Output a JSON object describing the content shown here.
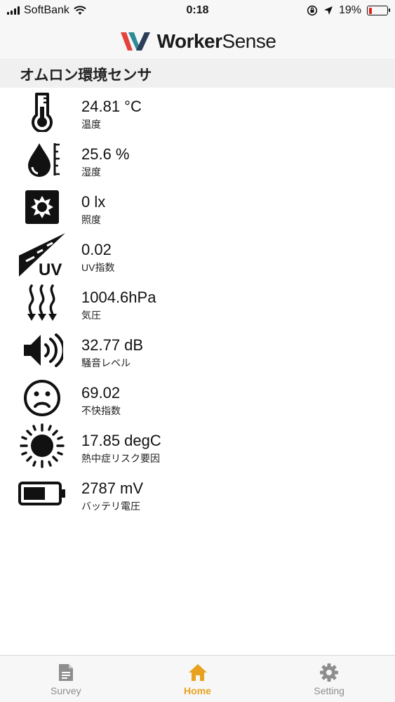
{
  "status_bar": {
    "carrier": "SoftBank",
    "time": "0:18",
    "battery": "19%",
    "battery_level": 0.19
  },
  "header": {
    "brand_bold": "Worker",
    "brand_light": "Sense"
  },
  "section": {
    "title": "オムロン環境センサ"
  },
  "sensors": [
    {
      "icon": "thermometer-icon",
      "value": "24.81 °C",
      "label": "温度"
    },
    {
      "icon": "humidity-drop-icon",
      "value": "25.6 %",
      "label": "湿度"
    },
    {
      "icon": "light-icon",
      "value": "0 lx",
      "label": "照度"
    },
    {
      "icon": "uv-icon",
      "value": "0.02",
      "label": "UV指数"
    },
    {
      "icon": "pressure-icon",
      "value": "1004.6hPa",
      "label": "気圧"
    },
    {
      "icon": "speaker-icon",
      "value": "32.77 dB",
      "label": "騒音レベル"
    },
    {
      "icon": "sad-face-icon",
      "value": "69.02",
      "label": "不快指数"
    },
    {
      "icon": "sun-icon",
      "value": "17.85 degC",
      "label": "熱中症リスク要因"
    },
    {
      "icon": "battery-icon",
      "value": "2787 mV",
      "label": "バッテリ電圧"
    }
  ],
  "tabbar": {
    "active_color": "#e9a21f",
    "inactive_color": "#8e8e8e",
    "tabs": [
      {
        "label": "Survey",
        "icon": "document-icon",
        "active": false
      },
      {
        "label": "Home",
        "icon": "home-icon",
        "active": true
      },
      {
        "label": "Setting",
        "icon": "gear-icon",
        "active": false
      }
    ]
  }
}
